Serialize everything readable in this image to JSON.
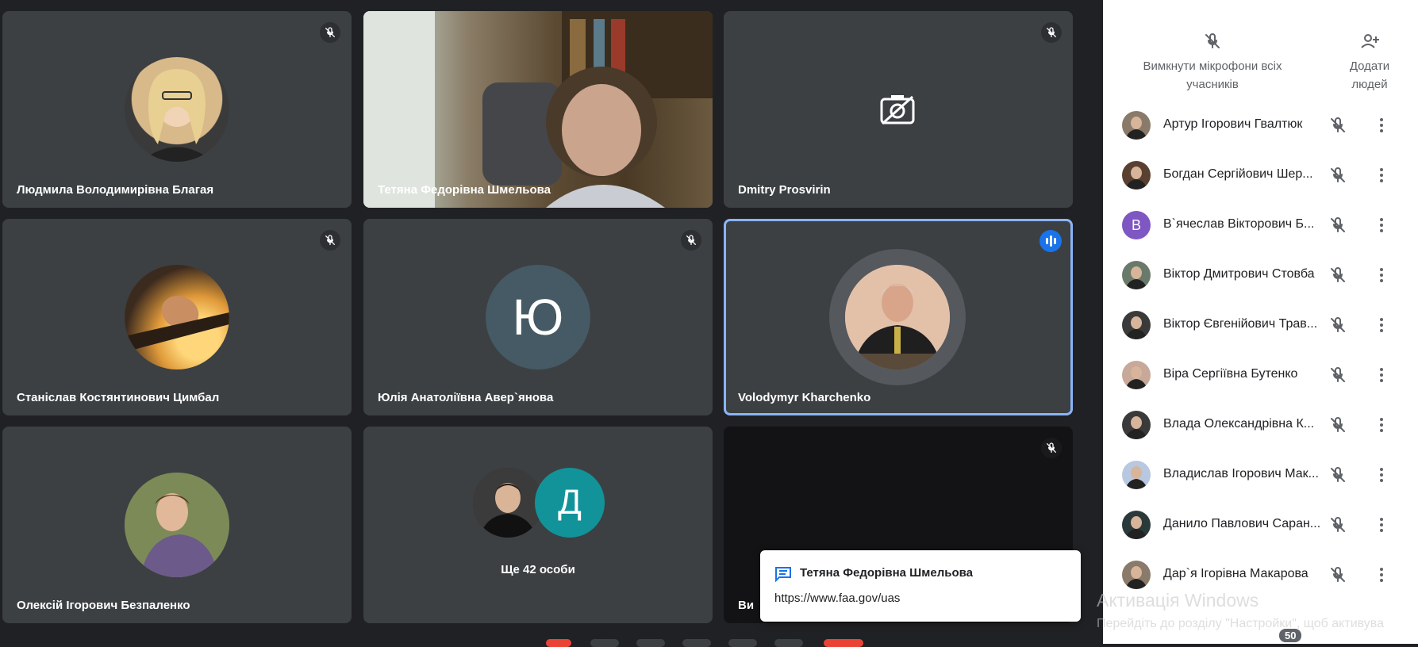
{
  "tiles": [
    {
      "name": "Людмила Володимирівна Благая"
    },
    {
      "name": "Тетяна Федорівна Шмельова"
    },
    {
      "name": "Dmitry Prosvirin"
    },
    {
      "name": "Станіслав Костянтинович Цимбал"
    },
    {
      "name": "Юлія Анатоліївна Авер`янова",
      "initial": "Ю"
    },
    {
      "name": "Volodymyr Kharchenko"
    },
    {
      "name": "Олексій Ігорович Безпаленко"
    },
    {
      "initial": "Д",
      "more_label": "Ще 42 особи"
    },
    {
      "name": "Ви"
    }
  ],
  "panel": {
    "mute_all_label": "Вимкнути мікрофони всіх учасників",
    "add_people_label": "Додати людей",
    "participants": [
      {
        "name": "Артур Ігорович Гвалтюк",
        "avatar": "photo"
      },
      {
        "name": "Богдан Сергійович Шер...",
        "avatar": "photo"
      },
      {
        "name": "В`ячеслав Вікторович Б...",
        "avatar": "letter",
        "initial": "В",
        "color": "#7e57c2"
      },
      {
        "name": "Віктор Дмитрович Стовба",
        "avatar": "photo"
      },
      {
        "name": "Віктор Євгенійович Трав...",
        "avatar": "photo"
      },
      {
        "name": "Віра Сергіївна Бутенко",
        "avatar": "photo"
      },
      {
        "name": "Влада Олександрівна К...",
        "avatar": "photo"
      },
      {
        "name": "Владислав Ігорович Мак...",
        "avatar": "photo"
      },
      {
        "name": "Данило Павлович Саран...",
        "avatar": "photo"
      },
      {
        "name": "Дар`я Ігорівна Макарова",
        "avatar": "photo"
      }
    ]
  },
  "chat_toast": {
    "sender": "Тетяна Федорівна Шмельова",
    "message": "https://www.faa.gov/uas",
    "icon": "chat-icon"
  },
  "watermark": {
    "title": "Активація Windows",
    "subtitle": "Перейдіть до розділу \"Настройки\", щоб активува"
  },
  "participants_badge": "50",
  "colors": {
    "accent": "#1a73e8",
    "tile_bg": "#3c4043",
    "stage_bg": "#202124",
    "letter_teal": "#12939a"
  }
}
